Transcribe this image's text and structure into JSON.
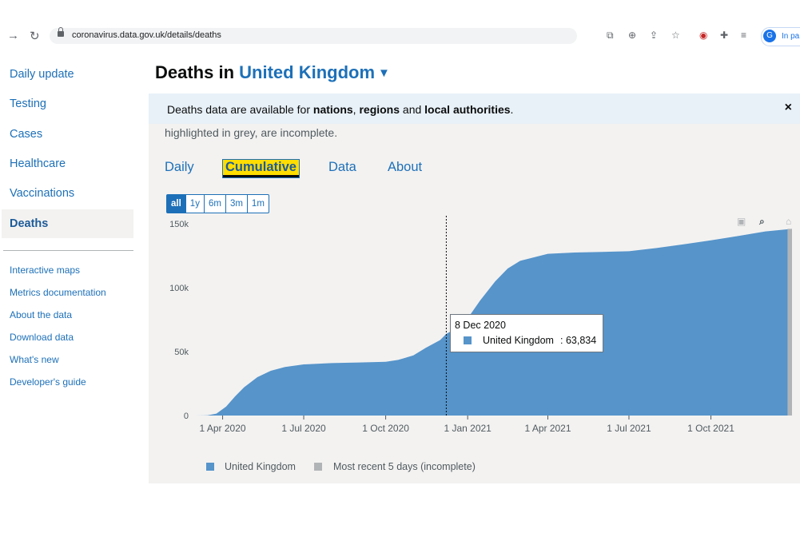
{
  "browser": {
    "url": "coronavirus.data.gov.uk/details/deaths",
    "profile_initial": "G",
    "profile_label": "In pa"
  },
  "sidebar": {
    "items": [
      {
        "label": "Daily update"
      },
      {
        "label": "Testing"
      },
      {
        "label": "Cases"
      },
      {
        "label": "Healthcare"
      },
      {
        "label": "Vaccinations"
      },
      {
        "label": "Deaths",
        "active": true
      }
    ],
    "links": [
      {
        "label": "Interactive maps"
      },
      {
        "label": "Metrics documentation"
      },
      {
        "label": "About the data"
      },
      {
        "label": "Download data"
      },
      {
        "label": "What's new"
      },
      {
        "label": "Developer's guide"
      }
    ]
  },
  "page": {
    "title_prefix": "Deaths in",
    "area": "United Kingdom"
  },
  "banner": {
    "text_1": "Deaths data are available for ",
    "nations": "nations",
    "sep": ", ",
    "regions": "regions",
    "and": " and ",
    "local": "local authorities",
    "end": ".",
    "close": "×"
  },
  "card": {
    "note": "highlighted in grey, are incomplete.",
    "tabs": [
      "Daily",
      "Cumulative",
      "Data",
      "About"
    ],
    "active_tab": "Cumulative",
    "range_buttons": [
      "all",
      "1y",
      "6m",
      "3m",
      "1m"
    ],
    "range_selected": "all"
  },
  "colors": {
    "series": "#5694ca",
    "incomplete": "#b1b4b6",
    "link": "#1d70b8",
    "focus": "#ffdd00"
  },
  "tooltip": {
    "date": "8 Dec 2020",
    "series": "United Kingdom",
    "value": ": 63,834"
  },
  "legend": [
    {
      "label": "United Kingdom",
      "color": "#5694ca"
    },
    {
      "label": "Most recent 5 days (incomplete)",
      "color": "#b1b4b6"
    }
  ],
  "chart_data": {
    "type": "area",
    "title": "",
    "xlabel": "",
    "ylabel": "",
    "ylim": [
      0,
      150000
    ],
    "y_ticks": [
      0,
      50000,
      100000,
      150000
    ],
    "y_tick_labels": [
      "0",
      "50k",
      "100k",
      "150k"
    ],
    "x_tick_labels": [
      "1 Apr 2020",
      "1 Jul 2020",
      "1 Oct 2020",
      "1 Jan 2021",
      "1 Apr 2021",
      "1 Jul 2021",
      "1 Oct 2021"
    ],
    "x_tick_dates": [
      "2020-04-01",
      "2020-07-01",
      "2020-10-01",
      "2021-01-01",
      "2021-04-01",
      "2021-07-01",
      "2021-10-01"
    ],
    "xlim": [
      "2020-03-01",
      "2021-12-31"
    ],
    "grid": false,
    "legend_position": "bottom",
    "series": [
      {
        "name": "United Kingdom",
        "x": [
          "2020-03-01",
          "2020-03-15",
          "2020-03-25",
          "2020-04-05",
          "2020-04-15",
          "2020-04-25",
          "2020-05-10",
          "2020-05-25",
          "2020-06-10",
          "2020-07-01",
          "2020-08-01",
          "2020-09-01",
          "2020-10-01",
          "2020-10-15",
          "2020-11-01",
          "2020-11-15",
          "2020-12-01",
          "2020-12-08",
          "2020-12-20",
          "2021-01-01",
          "2021-01-15",
          "2021-02-01",
          "2021-02-15",
          "2021-03-01",
          "2021-04-01",
          "2021-05-01",
          "2021-06-01",
          "2021-07-01",
          "2021-08-01",
          "2021-09-01",
          "2021-10-01",
          "2021-11-01",
          "2021-12-01",
          "2021-12-31"
        ],
        "values": [
          0,
          100,
          1500,
          7000,
          15000,
          22000,
          30000,
          35000,
          38000,
          40000,
          41000,
          41500,
          42000,
          43500,
          47000,
          53000,
          59000,
          63834,
          68500,
          76000,
          90000,
          105000,
          115000,
          121000,
          126500,
          127500,
          128000,
          128500,
          131000,
          134000,
          137000,
          140500,
          144000,
          146000
        ]
      }
    ],
    "incomplete_period": [
      "2021-12-26",
      "2021-12-31"
    ],
    "highlight_date": "2020-12-08"
  }
}
